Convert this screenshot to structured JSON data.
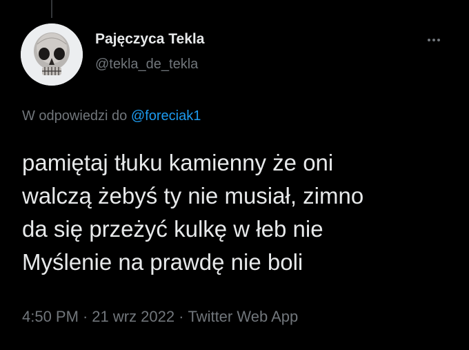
{
  "user": {
    "display_name": "Pajęczyca Tekla",
    "handle": "@tekla_de_tekla"
  },
  "reply": {
    "prefix": "W odpowiedzi do",
    "to": "@foreciak1"
  },
  "tweet": {
    "lines": [
      "pamiętaj tłuku kamienny że oni",
      "walczą żebyś ty nie musiał, zimno",
      "da się przeżyć kulkę w łeb nie",
      "Myślenie na prawdę nie boli"
    ]
  },
  "meta": {
    "time": "4:50 PM",
    "separator": "·",
    "date": "21 wrz 2022",
    "source": "Twitter Web App"
  },
  "icons": {
    "avatar": "skull-avatar",
    "more": "more-dots-icon"
  },
  "colors": {
    "background": "#000000",
    "text_primary": "#e7e9ea",
    "text_secondary": "#71767b",
    "link": "#1d9bf0"
  }
}
